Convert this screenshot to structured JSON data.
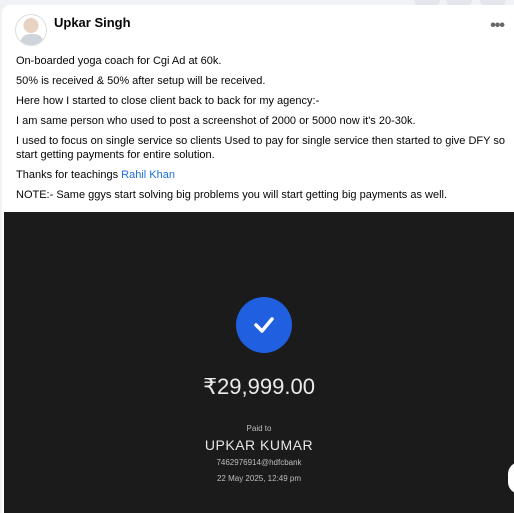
{
  "post": {
    "author": "Upkar Singh",
    "more_icon": "more-dots-icon",
    "paragraphs": [
      "On-boarded yoga coach for Cgi Ad at 60k.",
      "50% is received & 50% after setup will be received.",
      "Here how I started to close client back to back for my agency:-",
      "I am same person who used to post a screenshot of 2000 or 5000 now it's 20-30k.",
      "I used to focus on single service so clients Used to pay for single service then started to give DFY so start getting payments for entire solution."
    ],
    "thanks_prefix": "Thanks for teachings ",
    "thanks_link": "Rahil Khan",
    "note": "NOTE:- Same ggys start solving big problems you will start getting big payments as well."
  },
  "receipt": {
    "amount": "₹29,999.00",
    "paid_to_label": "Paid to",
    "payee": "UPKAR KUMAR",
    "upi_id": "7462976914@hdfcbank",
    "datetime": "22 May 2025, 12:49 pm",
    "accent": "#1f5fe0"
  }
}
